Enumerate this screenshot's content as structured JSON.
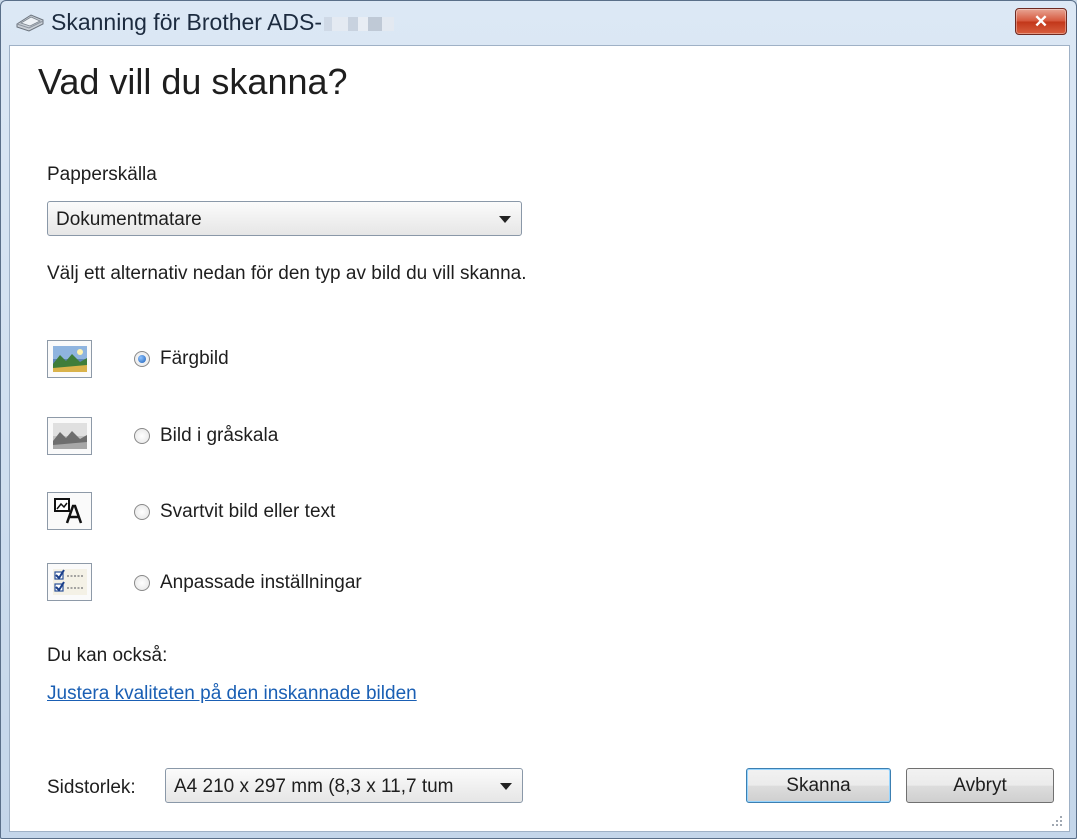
{
  "window": {
    "title": "Skanning för Brother ADS-",
    "close_label": "✕"
  },
  "main": {
    "heading": "Vad vill du skanna?",
    "paper_source_label": "Papperskälla",
    "paper_source_value": "Dokumentmatare",
    "instruction": "Välj ett alternativ nedan för den typ av bild du vill skanna.",
    "options": [
      {
        "label": "Färgbild",
        "selected": true,
        "icon": "color-picture-icon"
      },
      {
        "label": "Bild i gråskala",
        "selected": false,
        "icon": "grayscale-picture-icon"
      },
      {
        "label": "Svartvit bild eller text",
        "selected": false,
        "icon": "black-white-text-icon"
      },
      {
        "label": "Anpassade inställningar",
        "selected": false,
        "icon": "custom-settings-icon"
      }
    ],
    "also_label": "Du kan också:",
    "adjust_link": "Justera kvaliteten på den inskannade bilden"
  },
  "footer": {
    "page_size_label": "Sidstorlek:",
    "page_size_value": "A4 210 x 297 mm (8,3 x 11,7 tum",
    "scan_button": "Skanna",
    "cancel_button": "Avbryt"
  }
}
